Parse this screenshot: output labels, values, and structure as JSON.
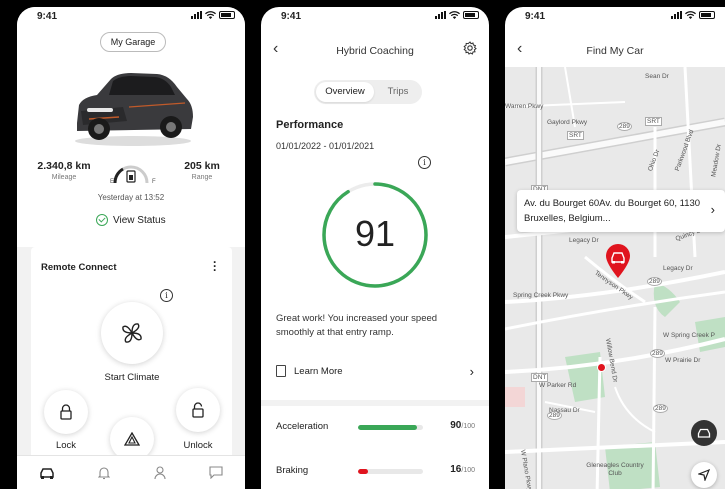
{
  "status": {
    "time": "9:41"
  },
  "garage": {
    "pill_label": "My Garage",
    "mileage_value": "2.340,8 km",
    "mileage_label": "Mileage",
    "range_value": "205 km",
    "range_label": "Range",
    "fuel_empty": "E",
    "fuel_full": "F",
    "updated": "Yesterday at 13:52",
    "view_status": "View Status",
    "remote_title": "Remote Connect",
    "climate_label": "Start Climate",
    "lock_label": "Lock",
    "unlock_label": "Unlock",
    "info_glyph": "i",
    "tabs": [
      "car-icon",
      "bell-icon",
      "person-icon",
      "chat-icon"
    ]
  },
  "coaching": {
    "title": "Hybrid Coaching",
    "tabs": [
      "Overview",
      "Trips"
    ],
    "section_title": "Performance",
    "date_range": "01/01/2022 - 01/01/2021",
    "score": "91",
    "score_fraction": 0.91,
    "message": "Great work! You increased your speed smoothly at that entry ramp.",
    "learn_more": "Learn More",
    "info_glyph": "i",
    "metrics": [
      {
        "name": "Acceleration",
        "value": "90",
        "max": "/100",
        "fraction": 0.9,
        "color": "#3aa757"
      },
      {
        "name": "Braking",
        "value": "16",
        "max": "/100",
        "fraction": 0.16,
        "color": "#e0141e"
      }
    ]
  },
  "findcar": {
    "title": "Find My Car",
    "address": "Av. du Bourget 60Av. du Bourget 60, 1130 Bruxelles, Belgium...",
    "roads": [
      "Sean Dr",
      "Warren Pkwy",
      "Gaylord Pkwy",
      "Ohio Dr",
      "Parkwood Blvd",
      "Legacy Dr",
      "Quincy Dr",
      "Tennyson Pkwy",
      "Legacy Dr",
      "Spring Creek Pkwy",
      "W Spring Creek P",
      "Willow Bend Dr",
      "W Prairie Dr",
      "W Parker Rd",
      "Nassau Dr",
      "Meadow Dr",
      "Gleneagles Country Club",
      "W Plano Pkwy",
      "DNT",
      "DNT",
      "SRT",
      "SRT",
      "289",
      "289",
      "289",
      "289",
      "289"
    ],
    "brand_red": "#e0141e"
  }
}
